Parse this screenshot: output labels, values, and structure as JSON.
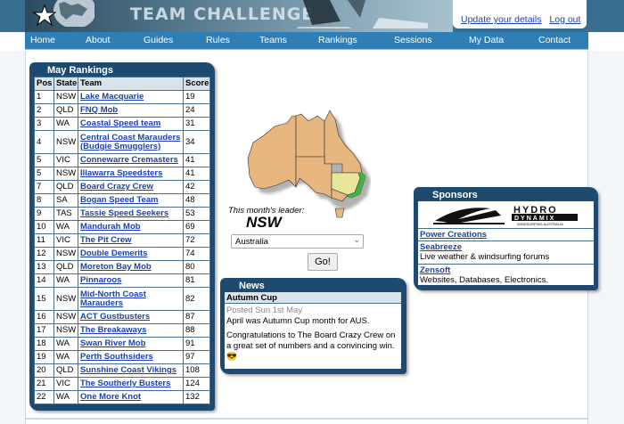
{
  "header": {
    "title": "TEAM CHALLENGE",
    "user_links": [
      "Update your details",
      "Log out"
    ]
  },
  "nav": {
    "items": [
      "Home",
      "About",
      "Guides",
      "Rules",
      "Teams",
      "Rankings",
      "Sessions",
      "My Data",
      "Contact"
    ]
  },
  "rankings": {
    "title": "May Rankings",
    "columns": [
      "Pos",
      "State",
      "Team",
      "Score"
    ],
    "rows": [
      {
        "pos": "1",
        "state": "NSW",
        "team": "Lake Macquarie",
        "score": "19"
      },
      {
        "pos": "2",
        "state": "QLD",
        "team": "FNQ Mob",
        "score": "24"
      },
      {
        "pos": "3",
        "state": "WA",
        "team": "Coastal Speed team",
        "score": "31"
      },
      {
        "pos": "4",
        "state": "NSW",
        "team": "Central Coast Marauders (Budgie Smugglers)",
        "score": "34"
      },
      {
        "pos": "5",
        "state": "VIC",
        "team": "Connewarre Cremasters",
        "score": "41"
      },
      {
        "pos": "5",
        "state": "NSW",
        "team": "Illawarra Speedsters",
        "score": "41"
      },
      {
        "pos": "7",
        "state": "QLD",
        "team": "Board Crazy Crew",
        "score": "42"
      },
      {
        "pos": "8",
        "state": "SA",
        "team": "Bogan Speed Team",
        "score": "48"
      },
      {
        "pos": "9",
        "state": "TAS",
        "team": "Tassie Speed Seekers",
        "score": "53"
      },
      {
        "pos": "10",
        "state": "WA",
        "team": "Mandurah Mob",
        "score": "69"
      },
      {
        "pos": "11",
        "state": "VIC",
        "team": "The Pit Crew",
        "score": "72"
      },
      {
        "pos": "12",
        "state": "NSW",
        "team": "Double Demerits",
        "score": "74"
      },
      {
        "pos": "13",
        "state": "QLD",
        "team": "Moreton Bay Mob",
        "score": "80"
      },
      {
        "pos": "14",
        "state": "WA",
        "team": "Pinnaroos",
        "score": "81"
      },
      {
        "pos": "15",
        "state": "NSW",
        "team": "Mid-North Coast Marauders",
        "score": "82"
      },
      {
        "pos": "16",
        "state": "NSW",
        "team": "ACT Gustbusters",
        "score": "87"
      },
      {
        "pos": "17",
        "state": "NSW",
        "team": "The Breakaways",
        "score": "88"
      },
      {
        "pos": "18",
        "state": "WA",
        "team": "Swan River Mob",
        "score": "91"
      },
      {
        "pos": "19",
        "state": "WA",
        "team": "Perth Southsiders",
        "score": "97"
      },
      {
        "pos": "20",
        "state": "QLD",
        "team": "Sunshine Coast Vikings",
        "score": "108"
      },
      {
        "pos": "21",
        "state": "VIC",
        "team": "The Southerly Busters",
        "score": "124"
      },
      {
        "pos": "22",
        "state": "WA",
        "team": "One More Knot",
        "score": "132"
      }
    ]
  },
  "leader": {
    "caption": "This month's leader:",
    "value": "NSW",
    "select_value": "Australia",
    "go_label": "Go!"
  },
  "news": {
    "title": "News",
    "headline": "Autumn Cup",
    "posted": "Posted Sun 1st May",
    "line1": "April was Autumn Cup month for AUS.",
    "line2": "Congratulations to The Board Crazy Crew on a great set of numbers and a convincing win.",
    "emoji": "😎"
  },
  "sponsors": {
    "title": "Sponsors",
    "logo_text": "HYDRO",
    "logo_sub": "DYNAMIX",
    "logo_tag": "WINDSURFING AUSTRALIA",
    "items": [
      {
        "name": "Power Creations",
        "desc": ""
      },
      {
        "name": "Seabreeze",
        "desc": "Live weather & windsurfing forums"
      },
      {
        "name": "Zensoft",
        "desc": "Websites, Databases, Electronics."
      }
    ]
  },
  "colors": {
    "nav_bg": "#2f7fb6",
    "panel_bg": "#1f4a70",
    "link": "#1a3fb0",
    "highlight_state": "#4caf50"
  }
}
